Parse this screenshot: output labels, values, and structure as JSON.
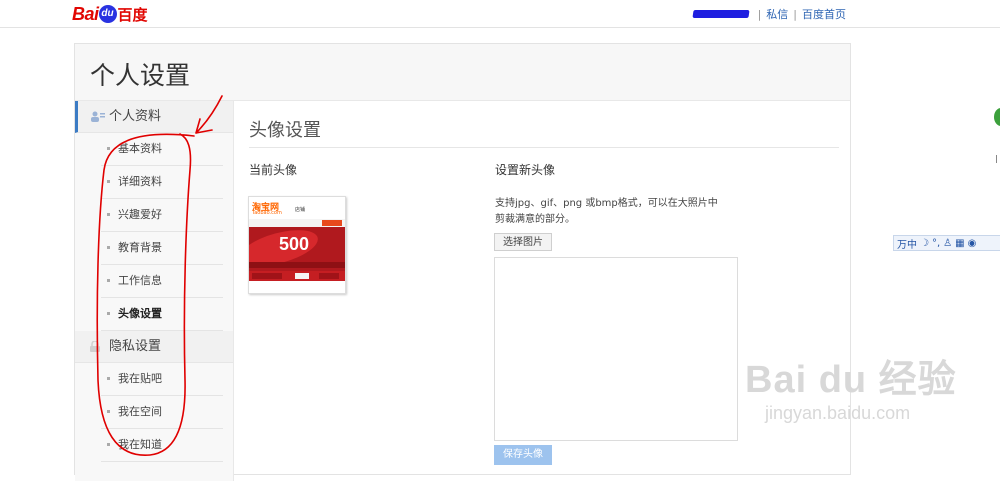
{
  "header": {
    "logo_text": "Bai",
    "logo_du": "du",
    "logo_cn": "百度",
    "username": "",
    "links": [
      "私信",
      "百度首页"
    ]
  },
  "panel": {
    "title": "个人设置"
  },
  "sidebar": {
    "groups": [
      {
        "label": "个人资料",
        "items": [
          "基本资料",
          "详细资料",
          "兴趣爱好",
          "教育背景",
          "工作信息",
          "头像设置"
        ]
      },
      {
        "label": "隐私设置",
        "items": [
          "我在贴吧",
          "我在空间",
          "我在知道"
        ]
      }
    ],
    "current_item": "头像设置"
  },
  "content": {
    "title": "头像设置",
    "current_label": "当前头像",
    "new_label": "设置新头像",
    "help_text": "支持jpg、gif、png 或bmp格式，可以在大照片中剪裁满意的部分。",
    "choose_button": "选择图片",
    "save_button": "保存头像"
  },
  "avatar": {
    "brand": "淘宝网",
    "brand_sub": "Taobao.com",
    "shop_label": "店铺",
    "big_number": "500"
  },
  "side_widget": {
    "text": "万中"
  },
  "watermark": {
    "main": "Bai du 经验",
    "sub": "jingyan.baidu.com"
  },
  "colors": {
    "brand_red": "#e10602",
    "brand_blue": "#2932e1",
    "link_blue": "#2d64b3",
    "active_bar": "#3b7bc4",
    "save_button": "#9dc3ee",
    "annotation_red": "#e00000"
  }
}
